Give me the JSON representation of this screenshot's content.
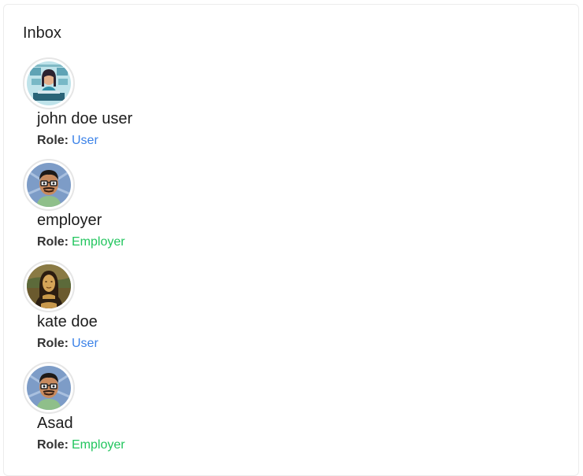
{
  "inbox": {
    "title": "Inbox",
    "contacts": [
      {
        "name": "john doe user",
        "role_label": "Role:",
        "role": "User",
        "role_color": "#3b82e8",
        "avatar": "illustration-developer-avatar"
      },
      {
        "name": "employer",
        "role_label": "Role:",
        "role": "Employer",
        "role_color": "#22c55e",
        "avatar": "cartoon-man-glasses-avatar"
      },
      {
        "name": "kate doe",
        "role_label": "Role:",
        "role": "User",
        "role_color": "#3b82e8",
        "avatar": "mona-lisa-avatar"
      },
      {
        "name": "Asad",
        "role_label": "Role:",
        "role": "Employer",
        "role_color": "#22c55e",
        "avatar": "cartoon-man-glasses-avatar"
      }
    ]
  }
}
